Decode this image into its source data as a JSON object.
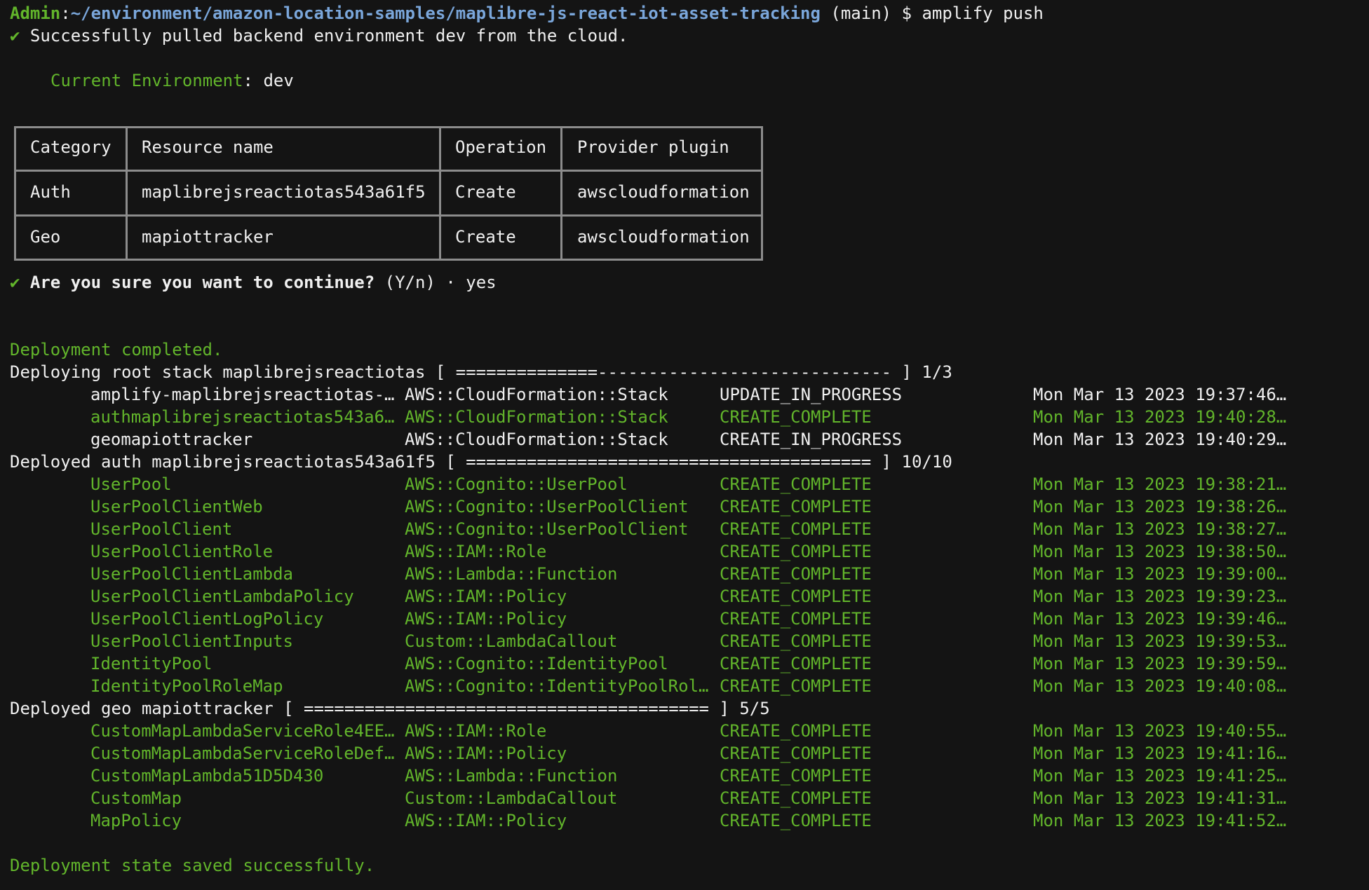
{
  "prompt": {
    "user": "Admin",
    "path": "~/environment/amazon-location-samples/maplibre-js-react-iot-asset-tracking",
    "branch": "(main)",
    "dollar": "$",
    "command": "amplify push"
  },
  "check_icon": "✔",
  "pulled_message": "Successfully pulled backend environment dev from the cloud.",
  "current_env": {
    "label": "Current Environment",
    "value": "dev"
  },
  "table": {
    "headers": [
      "Category",
      "Resource name",
      "Operation",
      "Provider plugin"
    ],
    "rows": [
      [
        "Auth",
        "maplibrejsreactiotas543a61f5",
        "Create",
        "awscloudformation"
      ],
      [
        "Geo",
        "mapiottracker",
        "Create",
        "awscloudformation"
      ]
    ]
  },
  "confirm": {
    "question": "Are you sure you want to continue?",
    "options": "(Y/n)",
    "separator": "·",
    "answer": "yes"
  },
  "deployment_completed": "Deployment completed.",
  "sections": [
    {
      "title": "Deploying root stack maplibrejsreactiotas [ ==============----------------------------- ] 1/3",
      "rows": [
        {
          "name": "amplify-maplibrejsreactiotas-…",
          "type": "AWS::CloudFormation::Stack",
          "status": "UPDATE_IN_PROGRESS",
          "time": "Mon Mar 13 2023 19:37:46…",
          "color": "white"
        },
        {
          "name": "authmaplibrejsreactiotas543a6…",
          "type": "AWS::CloudFormation::Stack",
          "status": "CREATE_COMPLETE",
          "time": "Mon Mar 13 2023 19:40:28…",
          "color": "green"
        },
        {
          "name": "geomapiottracker",
          "type": "AWS::CloudFormation::Stack",
          "status": "CREATE_IN_PROGRESS",
          "time": "Mon Mar 13 2023 19:40:29…",
          "color": "white"
        }
      ]
    },
    {
      "title": "Deployed auth maplibrejsreactiotas543a61f5 [ ======================================== ] 10/10",
      "rows": [
        {
          "name": "UserPool",
          "type": "AWS::Cognito::UserPool",
          "status": "CREATE_COMPLETE",
          "time": "Mon Mar 13 2023 19:38:21…",
          "color": "green"
        },
        {
          "name": "UserPoolClientWeb",
          "type": "AWS::Cognito::UserPoolClient",
          "status": "CREATE_COMPLETE",
          "time": "Mon Mar 13 2023 19:38:26…",
          "color": "green"
        },
        {
          "name": "UserPoolClient",
          "type": "AWS::Cognito::UserPoolClient",
          "status": "CREATE_COMPLETE",
          "time": "Mon Mar 13 2023 19:38:27…",
          "color": "green"
        },
        {
          "name": "UserPoolClientRole",
          "type": "AWS::IAM::Role",
          "status": "CREATE_COMPLETE",
          "time": "Mon Mar 13 2023 19:38:50…",
          "color": "green"
        },
        {
          "name": "UserPoolClientLambda",
          "type": "AWS::Lambda::Function",
          "status": "CREATE_COMPLETE",
          "time": "Mon Mar 13 2023 19:39:00…",
          "color": "green"
        },
        {
          "name": "UserPoolClientLambdaPolicy",
          "type": "AWS::IAM::Policy",
          "status": "CREATE_COMPLETE",
          "time": "Mon Mar 13 2023 19:39:23…",
          "color": "green"
        },
        {
          "name": "UserPoolClientLogPolicy",
          "type": "AWS::IAM::Policy",
          "status": "CREATE_COMPLETE",
          "time": "Mon Mar 13 2023 19:39:46…",
          "color": "green"
        },
        {
          "name": "UserPoolClientInputs",
          "type": "Custom::LambdaCallout",
          "status": "CREATE_COMPLETE",
          "time": "Mon Mar 13 2023 19:39:53…",
          "color": "green"
        },
        {
          "name": "IdentityPool",
          "type": "AWS::Cognito::IdentityPool",
          "status": "CREATE_COMPLETE",
          "time": "Mon Mar 13 2023 19:39:59…",
          "color": "green"
        },
        {
          "name": "IdentityPoolRoleMap",
          "type": "AWS::Cognito::IdentityPoolRol…",
          "status": "CREATE_COMPLETE",
          "time": "Mon Mar 13 2023 19:40:08…",
          "color": "green"
        }
      ]
    },
    {
      "title": "Deployed geo mapiottracker [ ======================================== ] 5/5",
      "rows": [
        {
          "name": "CustomMapLambdaServiceRole4EE…",
          "type": "AWS::IAM::Role",
          "status": "CREATE_COMPLETE",
          "time": "Mon Mar 13 2023 19:40:55…",
          "color": "green"
        },
        {
          "name": "CustomMapLambdaServiceRoleDef…",
          "type": "AWS::IAM::Policy",
          "status": "CREATE_COMPLETE",
          "time": "Mon Mar 13 2023 19:41:16…",
          "color": "green"
        },
        {
          "name": "CustomMapLambda51D5D430",
          "type": "AWS::Lambda::Function",
          "status": "CREATE_COMPLETE",
          "time": "Mon Mar 13 2023 19:41:25…",
          "color": "green"
        },
        {
          "name": "CustomMap",
          "type": "Custom::LambdaCallout",
          "status": "CREATE_COMPLETE",
          "time": "Mon Mar 13 2023 19:41:31…",
          "color": "green"
        },
        {
          "name": "MapPolicy",
          "type": "AWS::IAM::Policy",
          "status": "CREATE_COMPLETE",
          "time": "Mon Mar 13 2023 19:41:52…",
          "color": "green"
        }
      ]
    }
  ],
  "saved_message": "Deployment state saved successfully.",
  "colors": {
    "background": "#141414",
    "green": "#62b52b",
    "blue": "#7aa6da",
    "white": "#f0f0f0",
    "border": "#8c8c8c"
  }
}
